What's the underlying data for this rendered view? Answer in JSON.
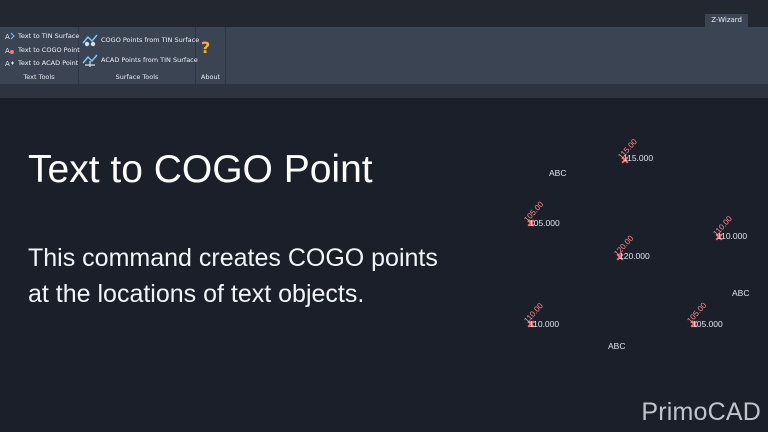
{
  "ribbon": {
    "tab": "Z-Wizard",
    "panels": [
      {
        "label": "Text Tools",
        "items": [
          "Text to TIN Surface",
          "Text to COGO Point",
          "Text to ACAD Point"
        ]
      },
      {
        "label": "Surface Tools",
        "items": [
          "COGO Points from TIN Surface",
          "ACAD Points from TIN Surface"
        ]
      },
      {
        "label": "About",
        "items": [
          "?"
        ]
      }
    ]
  },
  "slide": {
    "title": "Text to COGO Point",
    "description_line1": "This command creates COGO points",
    "description_line2": "at the locations of text objects."
  },
  "drawing": {
    "abc_1": "ABC",
    "abc_2": "ABC",
    "abc_3": "ABC",
    "v_115": "115.000",
    "v_105a": "105.000",
    "v_110a": "110.000",
    "v_120": "120.000",
    "v_110b": "110.000",
    "v_105b": "105.000",
    "p_115": "115.00",
    "p_105a": "105.00",
    "p_110a": "110.00",
    "p_120": "120.00",
    "p_110b": "110.00",
    "p_105b": "105.00"
  },
  "brand": "PrimoCAD"
}
